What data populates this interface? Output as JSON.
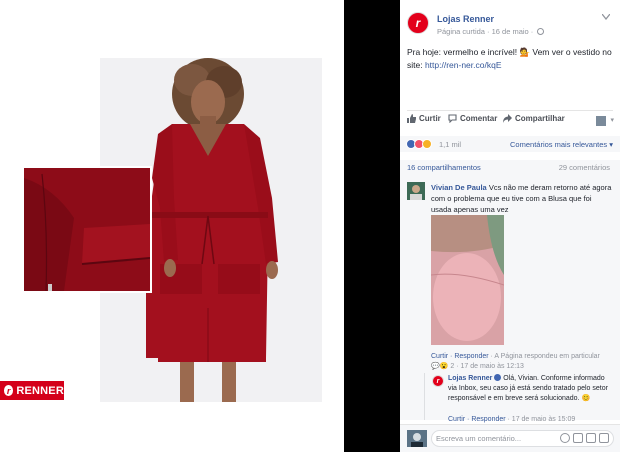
{
  "brand": {
    "badge_label": "RENNER",
    "badge_glyph": "r",
    "color": "#d4001a"
  },
  "post": {
    "page_name": "Lojas Renner",
    "page_avatar_glyph": "r",
    "meta": "Página curtida · 16 de maio ·",
    "text": "Pra hoje: vermelho e incrível! 💁 Vem ver o vestido no site: ",
    "link": "http://ren-ner.co/kqE"
  },
  "actions": {
    "like": "Curtir",
    "comment": "Comentar",
    "share": "Compartilhar"
  },
  "reactions": {
    "count": "1,1 mil",
    "sort_label": "Comentários mais relevantes ▾",
    "colors": [
      "#4267b2",
      "#f25268",
      "#f7b125"
    ]
  },
  "stats": {
    "shares": "16 compartilhamentos",
    "comments": "29 comentários"
  },
  "comments": [
    {
      "author": "Vivian De Paula",
      "text": "Vcs não me deram retorno até agora com o problema que eu tive com a Blusa que foi usada apenas uma vez",
      "meta_links": "Curtir · Responder",
      "meta_extra": " · A Página respondeu em particular",
      "meta_line2": "💬😮 2 · 17 de maio às 12:13"
    }
  ],
  "reply": {
    "author": "Lojas Renner",
    "text": "Olá, Vivian. Conforme informado via Inbox, seu caso já está sendo tratado pelo setor responsável e em breve será solucionado. 😊",
    "meta_links": "Curtir · Responder",
    "meta_time": " · 17 de maio às 15:09"
  },
  "composer": {
    "placeholder": "Escreva um comentário..."
  },
  "icons": [
    "globe-icon",
    "chevron-down-icon",
    "like-icon",
    "comment-icon",
    "share-icon",
    "verified-icon",
    "emoji-icon",
    "camera-icon",
    "gif-icon",
    "sticker-icon"
  ]
}
